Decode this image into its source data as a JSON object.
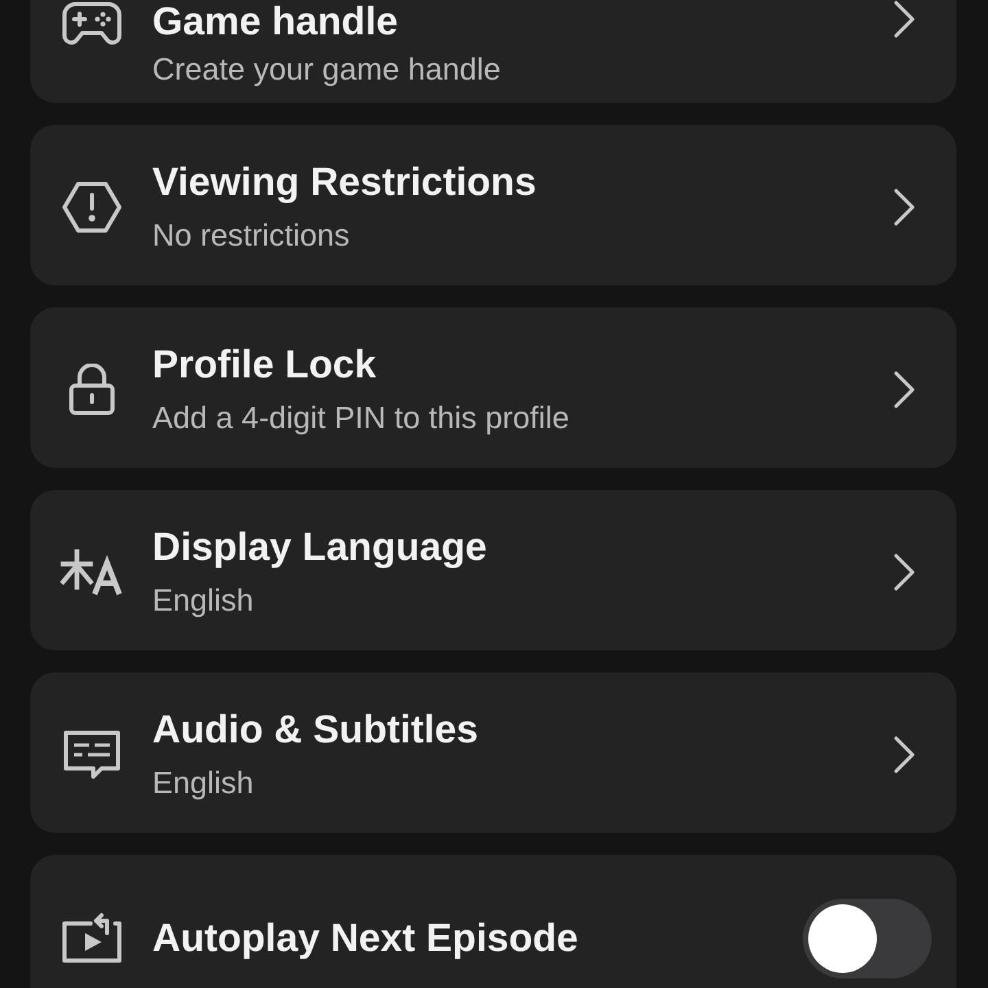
{
  "settings": [
    {
      "kind": "link",
      "title": "Game handle",
      "subtitle": "Create your game handle"
    },
    {
      "kind": "link",
      "title": "Viewing Restrictions",
      "subtitle": "No restrictions"
    },
    {
      "kind": "link",
      "title": "Profile Lock",
      "subtitle": "Add a 4-digit PIN to this profile"
    },
    {
      "kind": "link",
      "title": "Display Language",
      "subtitle": "English"
    },
    {
      "kind": "link",
      "title": "Audio & Subtitles",
      "subtitle": "English"
    },
    {
      "kind": "toggle",
      "title": "Autoplay Next Episode",
      "on": false
    }
  ]
}
